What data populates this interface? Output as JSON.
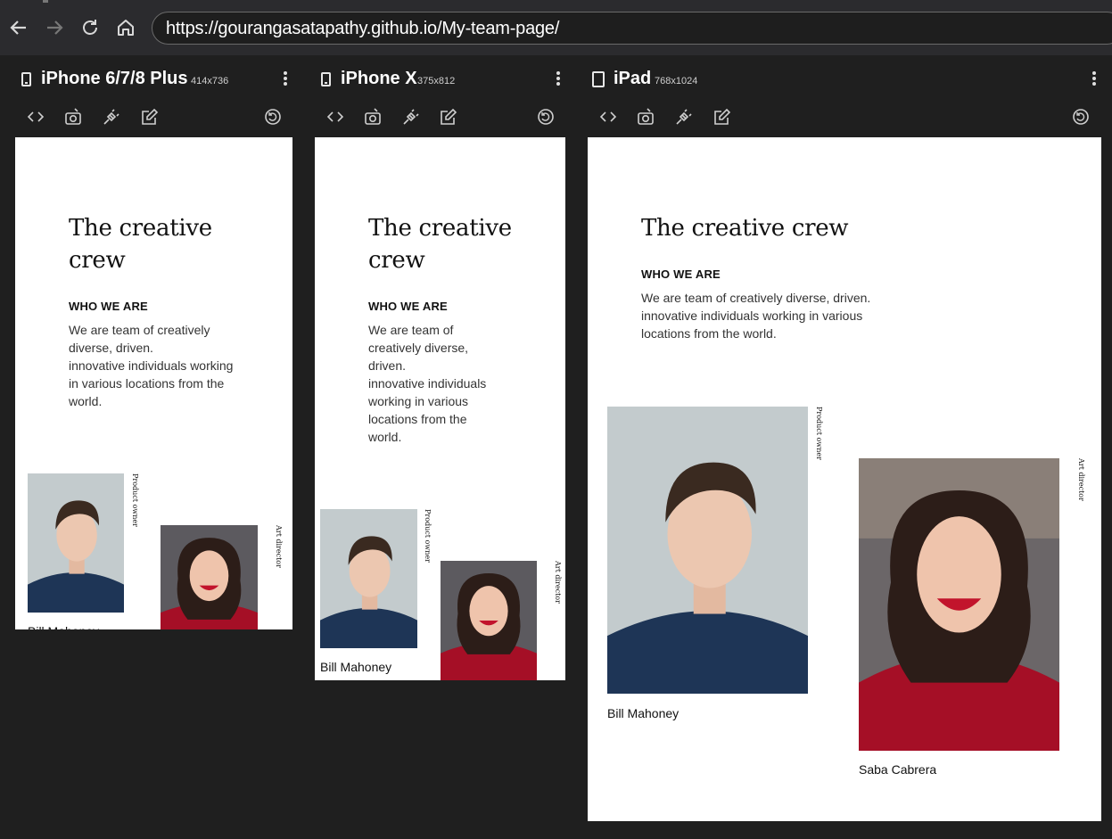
{
  "browser": {
    "url": "https://gourangasatapathy.github.io/My-team-page/",
    "nav_icons": [
      "back-arrow-icon",
      "forward-arrow-icon",
      "reload-icon",
      "home-icon"
    ]
  },
  "devices": [
    {
      "name": "iPhone 6/7/8 Plus",
      "dims": "414x736"
    },
    {
      "name": "iPhone X",
      "dims": "375x812"
    },
    {
      "name": "iPad",
      "dims": "768x1024"
    }
  ],
  "toolbar_icons": [
    "code-icon",
    "screenshot-icon",
    "network-plug-icon",
    "edit-icon",
    "rotate-icon"
  ],
  "page": {
    "title": "The creative crew",
    "section_heading": "WHO WE ARE",
    "paragraph_line1": "We are team of creatively diverse, driven.",
    "paragraph_line2": "innovative individuals working in various locations from the world.",
    "members": [
      {
        "name": "Bill Mahoney",
        "role": "Product owner"
      },
      {
        "name": "Saba Cabrera",
        "role": "Art director"
      }
    ]
  },
  "colors": {
    "browser_bg": "#1f1f1f",
    "toolbar_bg": "#2b2b2e",
    "page_bg": "#ffffff",
    "shirt_navy": "#1e3556",
    "sweater_red": "#a50f26"
  }
}
